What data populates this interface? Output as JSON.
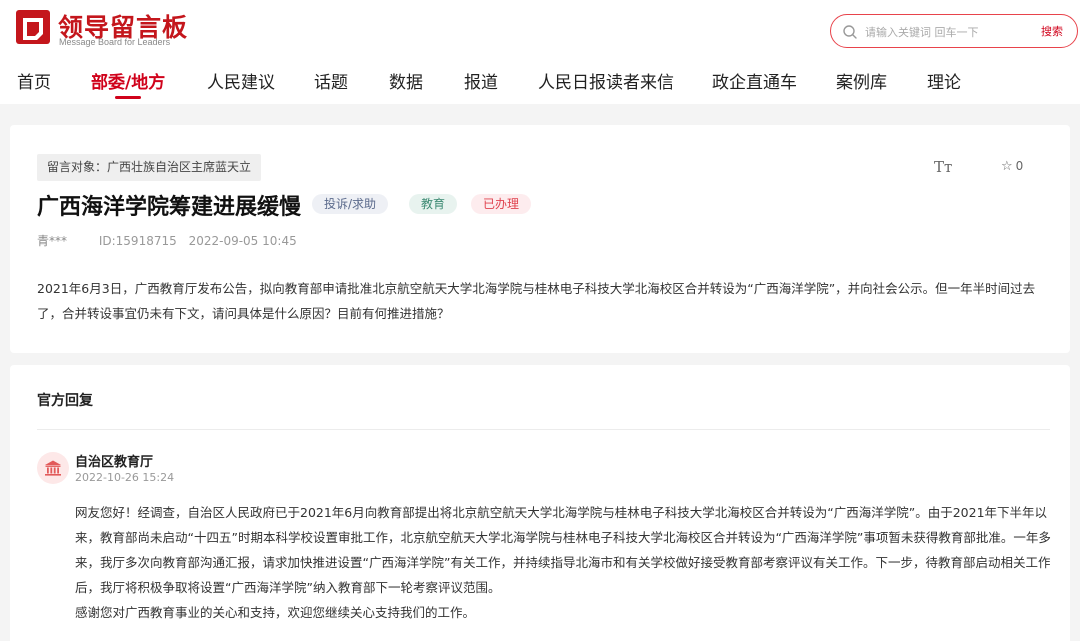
{
  "brand": {
    "title": "领导留言板",
    "subtitle": "Message Board for Leaders",
    "color": "#c4161c"
  },
  "search": {
    "placeholder": "请输入关键词 回车一下",
    "button_label": "搜索"
  },
  "nav": {
    "items": [
      {
        "label": "首页"
      },
      {
        "label": "部委/地方",
        "active": true
      },
      {
        "label": "人民建议"
      },
      {
        "label": "话题"
      },
      {
        "label": "数据"
      },
      {
        "label": "报道"
      },
      {
        "label": "人民日报读者来信"
      },
      {
        "label": "政企直通车"
      },
      {
        "label": "案例库"
      },
      {
        "label": "理论"
      }
    ]
  },
  "message": {
    "target": "留言对象：广西壮族自治区主席蓝天立",
    "title": "广西海洋学院筹建进展缓慢",
    "type_badge": "投诉/求助",
    "category_badge": "教育",
    "status_badge": "已办理",
    "author": "青***",
    "id": "ID:15918715",
    "datetime": "2022-09-05 10:45",
    "font_toggle": "Tт",
    "favorites": "0",
    "content": "2021年6月3日，广西教育厅发布公告，拟向教育部申请批准北京航空航天大学北海学院与桂林电子科技大学北海校区合并转设为“广西海洋学院”，并向社会公示。但一年半时间过去了，合并转设事宜仍未有下文，请问具体是什么原因？目前有何推进措施？"
  },
  "reply": {
    "heading": "官方回复",
    "organization": "自治区教育厅",
    "datetime": "2022-10-26 15:24",
    "paragraph1": "网友您好！经调查，自治区人民政府已于2021年6月向教育部提出将北京航空航天大学北海学院与桂林电子科技大学北海校区合并转设为“广西海洋学院”。由于2021年下半年以来，教育部尚未启动“十四五”时期本科学校设置审批工作，北京航空航天大学北海学院与桂林电子科技大学北海校区合并转设为“广西海洋学院”事项暂未获得教育部批准。一年多来，我厅多次向教育部沟通汇报，请求加快推进设置“广西海洋学院”有关工作，并持续指导北海市和有关学校做好接受教育部考察评议有关工作。下一步，待教育部启动相关工作后，我厅将积极争取将设置“广西海洋学院”纳入教育部下一轮考察评议范围。",
    "paragraph2": "感谢您对广西教育事业的关心和支持，欢迎您继续关心支持我们的工作。"
  }
}
